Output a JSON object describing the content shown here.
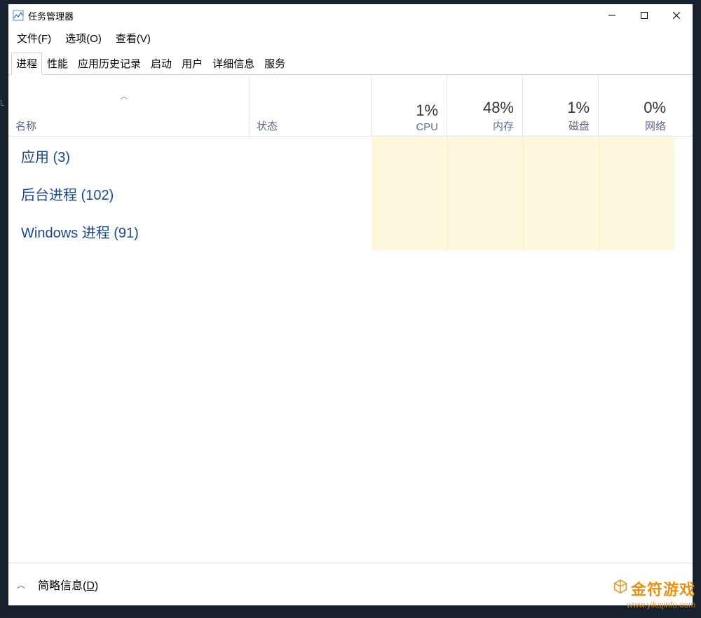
{
  "window": {
    "title": "任务管理器"
  },
  "menubar": {
    "file": "文件(F)",
    "options": "选项(O)",
    "view": "查看(V)"
  },
  "tabs": {
    "processes": "进程",
    "performance": "性能",
    "appHistory": "应用历史记录",
    "startup": "启动",
    "users": "用户",
    "details": "详细信息",
    "services": "服务"
  },
  "columns": {
    "name": "名称",
    "status": "状态",
    "cpu": {
      "pct": "1%",
      "label": "CPU"
    },
    "memory": {
      "pct": "48%",
      "label": "内存"
    },
    "disk": {
      "pct": "1%",
      "label": "磁盘"
    },
    "network": {
      "pct": "0%",
      "label": "网络"
    }
  },
  "groups": {
    "apps": "应用 (3)",
    "background": "后台进程 (102)",
    "windows": "Windows 进程 (91)"
  },
  "statusbar": {
    "briefInfo": "简略信息(D)"
  },
  "watermark": {
    "line1": "金符游戏",
    "line2": "www.yikajinfu.com"
  }
}
